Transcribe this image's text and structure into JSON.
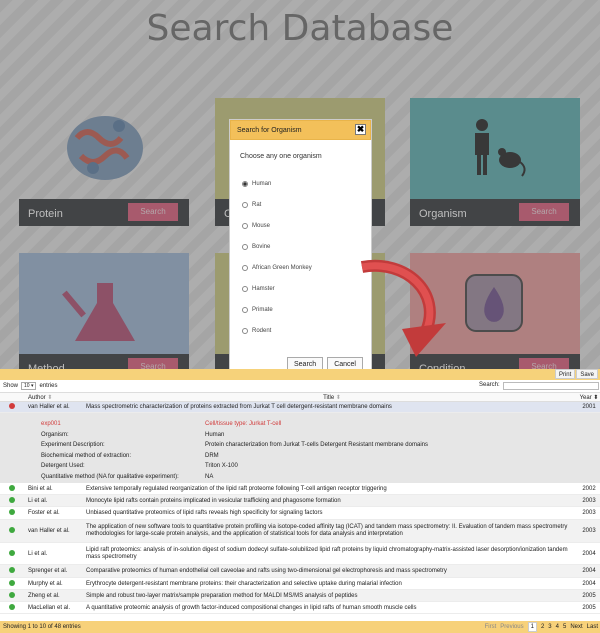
{
  "page_title": "Search Database",
  "cards": [
    {
      "label": "Protein",
      "button": "Search"
    },
    {
      "label": "C",
      "button": ""
    },
    {
      "label": "Organism",
      "button": "Search"
    },
    {
      "label": "Method",
      "button": "Search"
    },
    {
      "label": "",
      "button": ""
    },
    {
      "label": "Condition",
      "button": "Search"
    }
  ],
  "modal": {
    "title": "Search for Organism",
    "close": "✖",
    "prompt": "Choose any one organism",
    "options": [
      "Human",
      "Rat",
      "Mouse",
      "Bovine",
      "African Green Monkey",
      "Hamster",
      "Primate",
      "Rodent"
    ],
    "selected": "Human",
    "search_label": "Search",
    "cancel_label": "Cancel"
  },
  "table": {
    "show_label": "Show",
    "show_value": "10",
    "entries_label": "entries",
    "search_label": "Search:",
    "print_label": "Print",
    "save_label": "Save",
    "headers": {
      "author": "Author",
      "title": "Title",
      "year": "Year"
    },
    "expanded": {
      "author": "van Haller et al.",
      "title": "Mass spectrometric characterization of proteins extracted from Jurkat T cell detergent-resistant membrane domains",
      "year": "2001",
      "exp_id": "exp001",
      "cell_issue": "Cell/tissue type: Jurkat T-cell",
      "details": [
        {
          "key": "Organism:",
          "value": "Human"
        },
        {
          "key": "Experiment Description:",
          "value": "Protein characterization from Jurkat T-cells Detergent Resistant membrane domains"
        },
        {
          "key": "Biochemical method of extraction:",
          "value": "DRM"
        },
        {
          "key": "Detergent Used:",
          "value": "Triton X-100"
        },
        {
          "key": "Quantitative method (NA for qualitative experiment):",
          "value": "NA"
        }
      ]
    },
    "rows": [
      {
        "author": "Bini et al.",
        "title": "Extensive temporally regulated reorganization of the lipid raft proteome following T-cell antigen receptor triggering",
        "year": "2002"
      },
      {
        "author": "Li et al.",
        "title": "Monocyte lipid rafts contain proteins implicated in vesicular trafficking and phagosome formation",
        "year": "2003"
      },
      {
        "author": "Foster et al.",
        "title": "Unbiased quantitative proteomics of lipid rafts reveals high specificity for signaling factors",
        "year": "2003"
      },
      {
        "author": "van Haller et al.",
        "title": "The application of new software tools to quantitative protein profiling via isotope-coded affinity tag (ICAT) and tandem mass spectrometry: II. Evaluation of tandem mass spectrometry methodologies for large-scale protein analysis, and the application of statistical tools for data analysis and interpretation",
        "year": "2003"
      },
      {
        "author": "Li et al.",
        "title": "Lipid raft proteomics: analysis of in-solution digest of sodium dodecyl sulfate-solubilized lipid raft proteins by liquid chromatography-matrix-assisted laser desorption/ionization tandem mass spectrometry",
        "year": "2004"
      },
      {
        "author": "Sprenger et al.",
        "title": "Comparative proteomics of human endothelial cell caveolae and rafts using two-dimensional gel electrophoresis and mass spectrometry",
        "year": "2004"
      },
      {
        "author": "Murphy et al.",
        "title": "Erythrocyte detergent-resistant membrane proteins: their characterization and selective uptake during malarial infection",
        "year": "2004"
      },
      {
        "author": "Zheng et al.",
        "title": "Simple and robust two-layer matrix/sample preparation method for MALDI MS/MS analysis of peptides",
        "year": "2005"
      },
      {
        "author": "MacLellan et al.",
        "title": "A quantitative proteomic analysis of growth factor-induced compositional changes in lipid rafts of human smooth muscle cells",
        "year": "2005"
      }
    ],
    "footer": "Showing 1 to 10 of 48 entries",
    "pager": [
      "First",
      "Previous",
      "1",
      "2",
      "3",
      "4",
      "5",
      "Next",
      "Last"
    ]
  },
  "colors": {
    "accent": "#f3c05a",
    "search_button": "#dc5a7a",
    "card_bar": "#33363a"
  }
}
